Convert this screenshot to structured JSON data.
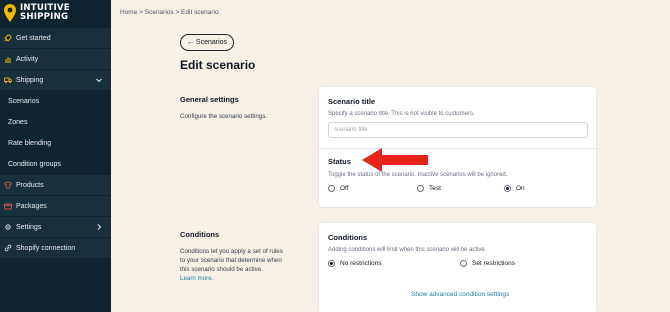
{
  "brand": {
    "line1": "INTUITIVE",
    "line2": "SHIPPING",
    "pin_color": "#f5b800"
  },
  "sidebar": {
    "items": [
      {
        "label": "Get started",
        "icon": "rocket-icon"
      },
      {
        "label": "Activity",
        "icon": "activity-chart-icon"
      },
      {
        "label": "Shipping",
        "icon": "truck-icon",
        "expanded": true
      },
      {
        "label": "Scenarios"
      },
      {
        "label": "Zones"
      },
      {
        "label": "Rate blending"
      },
      {
        "label": "Condition groups"
      },
      {
        "label": "Products",
        "icon": "shirt-icon"
      },
      {
        "label": "Packages",
        "icon": "package-icon"
      },
      {
        "label": "Settings",
        "icon": "gear-icon"
      },
      {
        "label": "Shopify connection",
        "icon": "link-icon"
      }
    ]
  },
  "breadcrumb": "Home > Scenarios > Edit scenario",
  "back_button": "← Scenarios",
  "page_title": "Edit scenario",
  "general": {
    "title": "General settings",
    "desc": "Configure the scenario settings."
  },
  "scenario_card": {
    "title": "Scenario title",
    "help": "Specify a scenario title. This is not visible to customers.",
    "placeholder": "scenario title",
    "status_title": "Status",
    "status_help": "Toggle the status of the scenario. Inactive scenarios will be ignored.",
    "options": [
      "Off",
      "Test",
      "On"
    ],
    "selected": "On"
  },
  "conditions_section": {
    "title": "Conditions",
    "desc_lines": [
      "Conditions let you apply a set of rules",
      "to your scenario that determine when",
      "this scenario should be active."
    ],
    "learn_more": "Learn more."
  },
  "conditions_card": {
    "title": "Conditions",
    "help": "Adding conditions will limit when this scenario will be active.",
    "options": [
      "No restrictions",
      "Set restrictions"
    ],
    "selected": "No restrictions",
    "advanced_link": "Show advanced condition settings"
  },
  "colors": {
    "sidebar_bg": "#0e2530",
    "page_bg": "#f6f0e6",
    "arrow": "#e8231b",
    "link": "#1d7fa6"
  }
}
